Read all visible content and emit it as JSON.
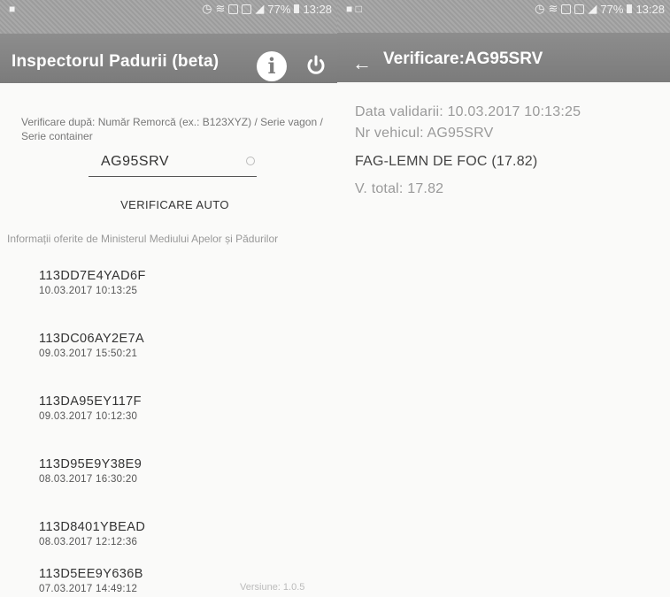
{
  "left_screen": {
    "status_bar": {
      "left": "a",
      "right": "77%",
      "time": "13:28"
    },
    "app_bar": {
      "title": "Inspectorul Padurii (beta)",
      "info_icon": "info-icon",
      "power_icon": "power-icon"
    },
    "search": {
      "hint": "Verificare după: Număr Remorcă (ex.: B123XYZ) / Serie vagon / Serie container",
      "value": "AG95SRV",
      "button_label": "VERIFICARE AUTO"
    },
    "info_note": "Informații oferite de Ministerul Mediului Apelor și Pădurilor",
    "records": [
      {
        "code": "113DD7E4YAD6F",
        "date": "10.03.2017 10:13:25"
      },
      {
        "code": "113DC06AY2E7A",
        "date": "09.03.2017 15:50:21"
      },
      {
        "code": "113DA95EY117F",
        "date": "09.03.2017 10:12:30"
      },
      {
        "code": "113D95E9Y38E9",
        "date": "08.03.2017 16:30:20"
      },
      {
        "code": "113D8401YBEAD",
        "date": "08.03.2017 12:12:36"
      },
      {
        "code": "113D5EE9Y636B",
        "date": "07.03.2017 14:49:12"
      }
    ],
    "version": "Versiune: 1.0.5"
  },
  "right_screen": {
    "status_bar": {
      "right": "77%",
      "time": "13:28"
    },
    "app_bar": {
      "back_icon": "back-arrow-icon",
      "title": "Verificare:AG95SRV"
    },
    "details": {
      "validation": "Data validarii: 10.03.2017 10:13:25",
      "vehicle": "Nr vehicul: AG95SRV",
      "product": "FAG-LEMN DE FOC (17.82)",
      "total": "V. total: 17.82"
    }
  },
  "colors": {
    "app_bar": "#858585",
    "status_bar": "#a3a3a3",
    "background": "#fafaf9"
  }
}
